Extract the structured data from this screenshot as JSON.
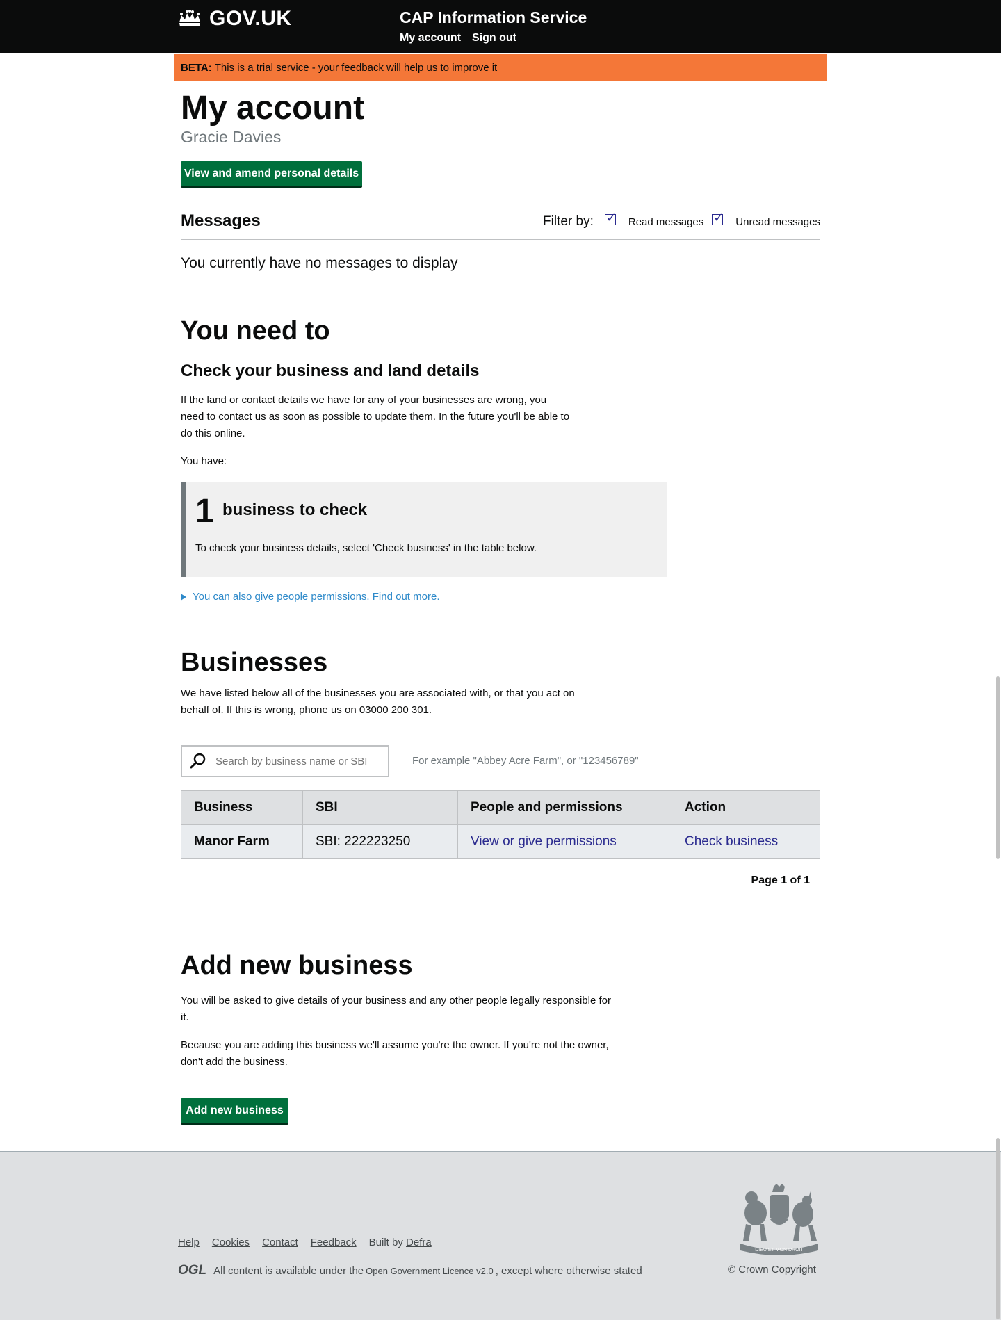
{
  "header": {
    "logo_text": "GOV.UK",
    "service_name": "CAP Information Service",
    "nav": [
      "My account",
      "Sign out"
    ]
  },
  "beta": {
    "tag": "BETA:",
    "text_before": "This is a trial service - your",
    "link": "feedback",
    "text_after": "will help us to improve it"
  },
  "account": {
    "title": "My account",
    "user_name": "Gracie Davies",
    "personal_button": "View and amend personal details"
  },
  "messages": {
    "title": "Messages",
    "filter_label": "Filter by:",
    "read_label": "Read messages",
    "unread_label": "Unread messages",
    "empty_text": "You currently have no messages to display"
  },
  "need_to": {
    "title": "You need to",
    "subtitle": "Check your business and land details",
    "description": "If the land or contact details we have for any of your businesses are wrong, you need to contact us as soon as possible to update them. In the future you'll be able to do this online.",
    "you_have": "You have:",
    "panel_number": "1",
    "panel_title": "business to check",
    "panel_text": "To check your business details, select 'Check business' in the table below.",
    "details_link": "You can also give people permissions. Find out more."
  },
  "businesses": {
    "title": "Businesses",
    "description": "We have listed below all of the businesses you are associated with, or that you act on behalf of. If this is wrong, phone us on 03000 200 301.",
    "search_placeholder": "Search by business name or SBI",
    "search_hint": "For example \"Abbey Acre Farm\", or \"123456789\"",
    "columns": [
      "Business",
      "SBI",
      "People and permissions",
      "Action"
    ],
    "rows": [
      {
        "business": "Manor Farm",
        "sbi": "SBI: 222223250",
        "permissions_link": "View or give permissions",
        "action_link": "Check business"
      }
    ],
    "pagination": "Page 1 of 1"
  },
  "add_business": {
    "title": "Add new business",
    "text1": "You will be asked to give details of your business and any other people legally responsible for it.",
    "text2": "Because you are adding this business we'll assume you're the owner. If you're not the owner, don't add the business.",
    "button": "Add new business"
  },
  "footer": {
    "links": [
      "Help",
      "Cookies",
      "Contact",
      "Feedback"
    ],
    "built_by": "Built by",
    "built_by_link": "Defra",
    "ogl_logo": "OGL",
    "licence_before": "All content is available under the",
    "licence_link": "Open Government Licence v2.0",
    "licence_after": ", except where otherwise stated",
    "copyright": "© Crown Copyright",
    "crest_motto": "DIEU ET MON DROIT"
  },
  "colors": {
    "header_bg": "#0b0c0c",
    "beta_bg": "#f47738",
    "button_green": "#00703c",
    "link_blue": "#2b2b8f",
    "footer_bg": "#dee0e2"
  }
}
